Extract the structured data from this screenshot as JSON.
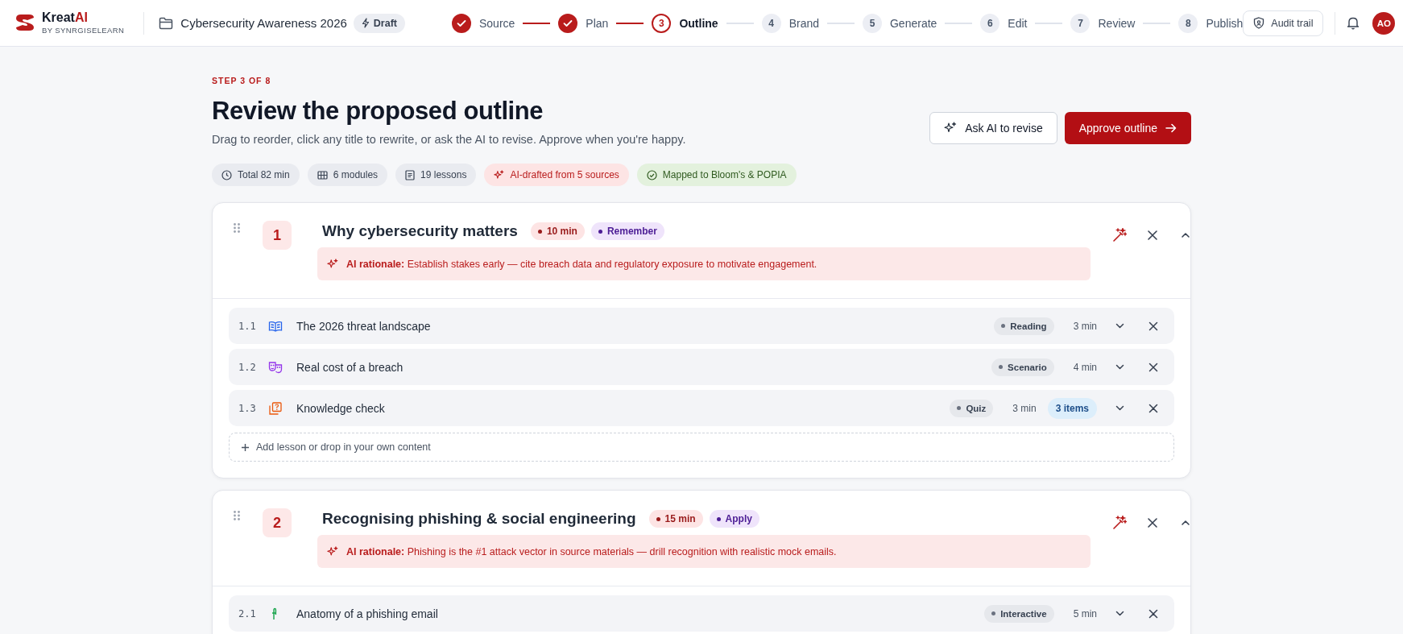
{
  "brand": {
    "name": "Kreat",
    "accent": "AI",
    "tagline": "BY SYNRGISELEARN"
  },
  "project": {
    "title": "Cybersecurity Awareness 2026",
    "status": "Draft"
  },
  "steps": [
    {
      "label": "Source",
      "completed": true,
      "selected": false
    },
    {
      "label": "Plan",
      "completed": true,
      "selected": false
    },
    {
      "number": "3",
      "label": "Outline",
      "completed": false,
      "selected": true
    },
    {
      "number": "4",
      "label": "Brand",
      "completed": false,
      "selected": false
    },
    {
      "number": "5",
      "label": "Generate",
      "completed": false,
      "selected": false
    },
    {
      "number": "6",
      "label": "Edit",
      "completed": false,
      "selected": false
    },
    {
      "number": "7",
      "label": "Review",
      "completed": false,
      "selected": false
    },
    {
      "number": "8",
      "label": "Publish",
      "completed": false,
      "selected": false
    }
  ],
  "header_actions": {
    "audit": "Audit trail",
    "avatar": "AO"
  },
  "page": {
    "eyebrow": "STEP 3 OF 8",
    "title": "Review the proposed outline",
    "subtitle": "Drag to reorder, click any title to rewrite, or ask the AI to revise. Approve when you're happy.",
    "revise_button": "Ask AI to revise",
    "approve_button": "Approve outline"
  },
  "chips": [
    {
      "kind": "time",
      "label": "Total 82 min"
    },
    {
      "kind": "modules",
      "label": "6 modules"
    },
    {
      "kind": "lessons",
      "label": "19 lessons"
    },
    {
      "kind": "ai",
      "label": "AI-drafted from 5 sources"
    },
    {
      "kind": "mapped",
      "label": "Mapped to Bloom's & POPIA"
    }
  ],
  "modules": [
    {
      "number": "1",
      "title": "Why cybersecurity matters",
      "duration": "10 min",
      "bloom": "Remember",
      "rationale": "**AI rationale:** Establish stakes early — cite breach data and regulatory exposure to motivate engagement.",
      "expanded": true,
      "lessons": [
        {
          "number": "1.1",
          "kind": "reading",
          "title": "The 2026 threat landscape",
          "type": "Reading",
          "duration": "3 min"
        },
        {
          "number": "1.2",
          "kind": "scenario",
          "title": "Real cost of a breach",
          "type": "Scenario",
          "duration": "4 min"
        },
        {
          "number": "1.3",
          "kind": "quiz",
          "title": "Knowledge check",
          "type": "Quiz",
          "duration": "3 min",
          "items": "3 items"
        }
      ],
      "add_label": "Add lesson or drop in your own content"
    },
    {
      "number": "2",
      "title": "Recognising phishing & social engineering",
      "duration": "15 min",
      "bloom": "Apply",
      "rationale": "**AI rationale:** Phishing is the #1 attack vector in source materials — drill recognition with realistic mock emails.",
      "expanded": true,
      "lessons": [
        {
          "number": "2.1",
          "kind": "interactive",
          "title": "Anatomy of a phishing email",
          "type": "Interactive",
          "duration": "5 min"
        }
      ]
    }
  ]
}
